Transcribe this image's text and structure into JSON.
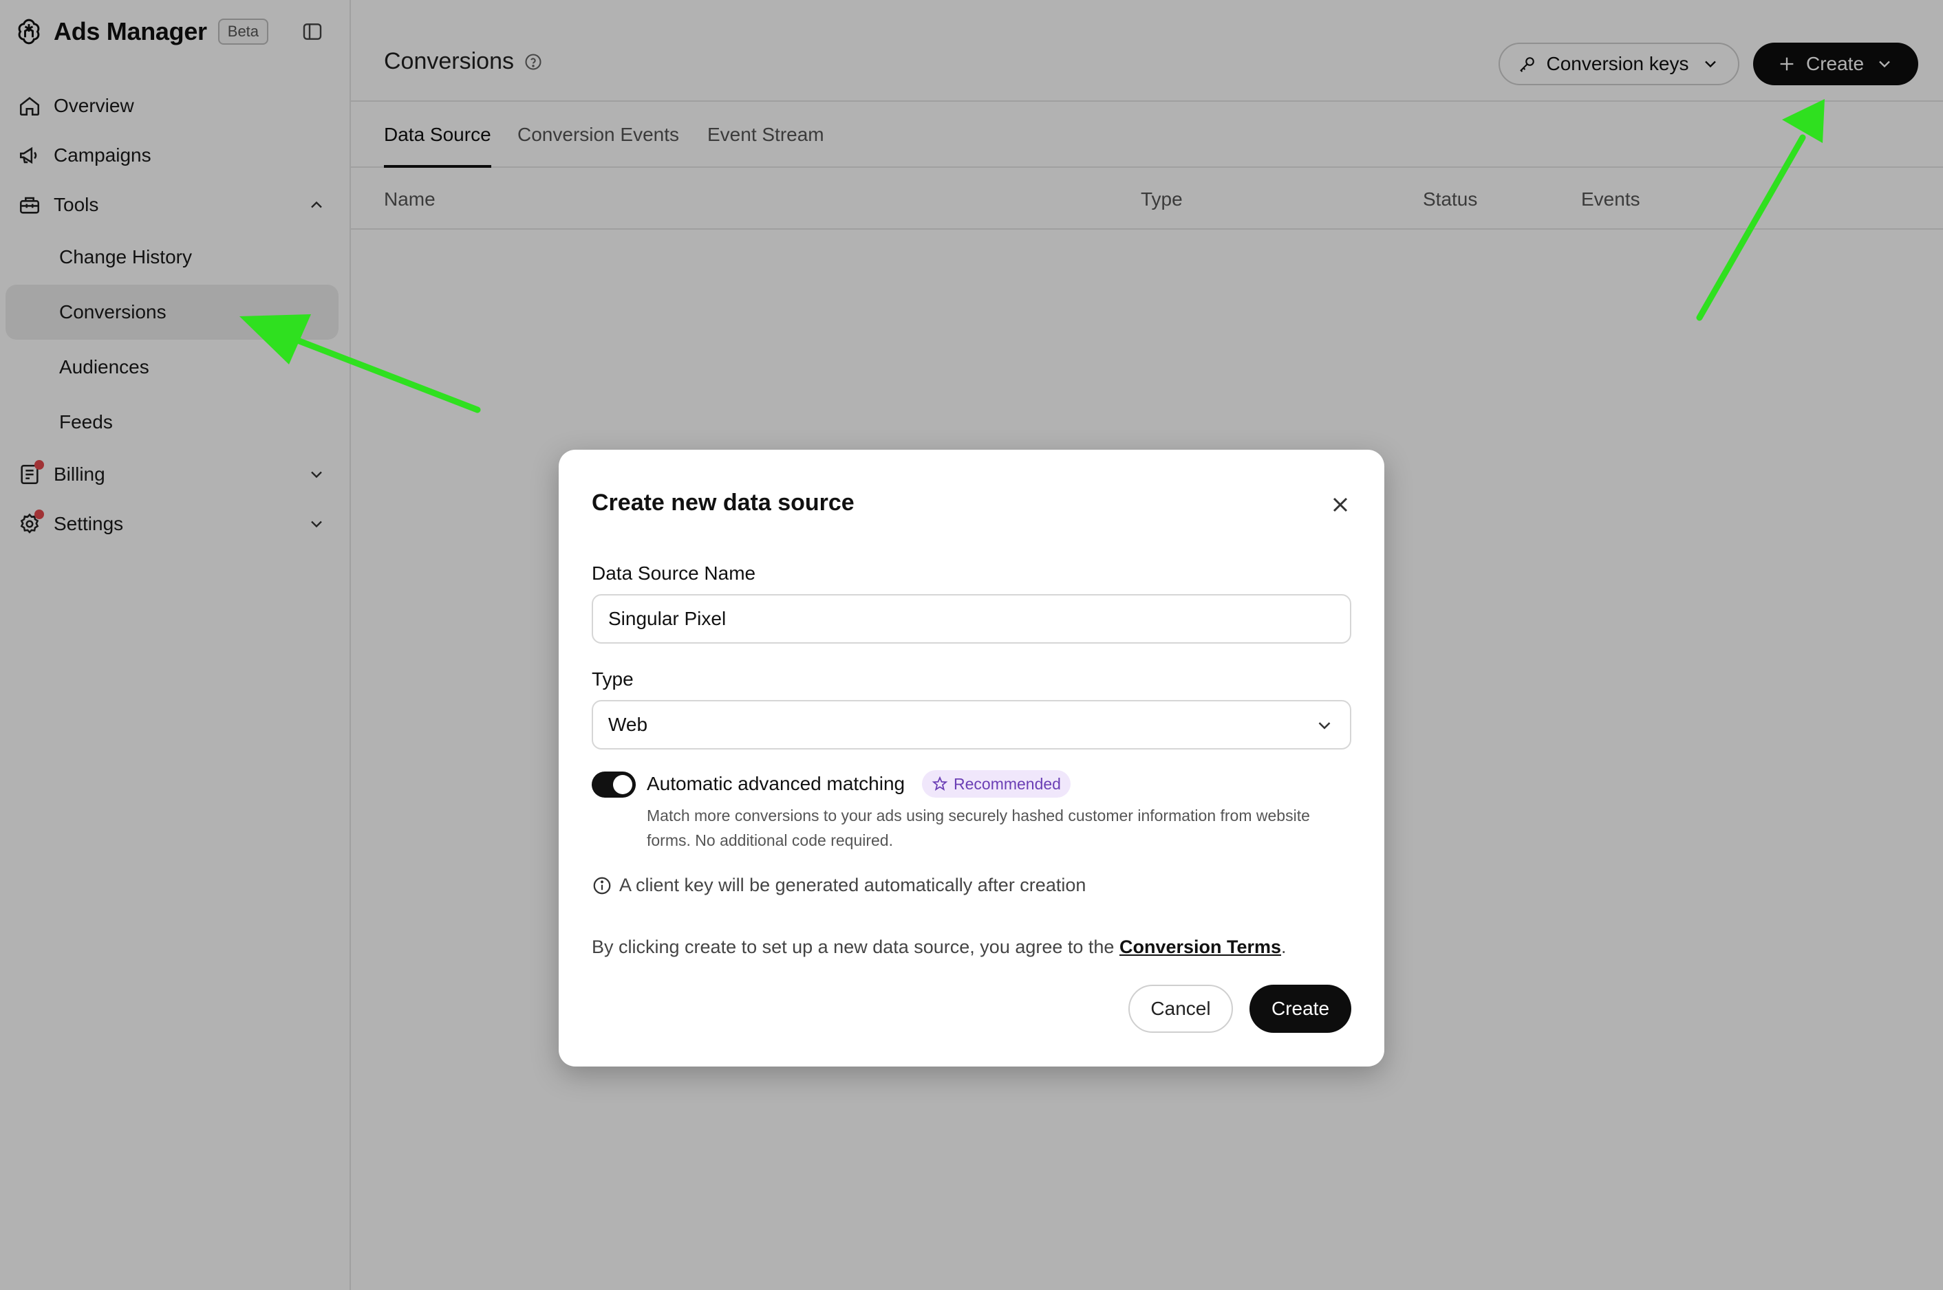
{
  "app": {
    "name": "Ads Manager",
    "badge": "Beta"
  },
  "sidebar": {
    "items": [
      {
        "label": "Overview"
      },
      {
        "label": "Campaigns"
      },
      {
        "label": "Tools"
      },
      {
        "label": "Change History"
      },
      {
        "label": "Conversions"
      },
      {
        "label": "Audiences"
      },
      {
        "label": "Feeds"
      },
      {
        "label": "Billing"
      },
      {
        "label": "Settings"
      }
    ]
  },
  "header": {
    "title": "Conversions",
    "conversion_keys_label": "Conversion keys",
    "create_label": "Create"
  },
  "tabs": [
    {
      "label": "Data Source"
    },
    {
      "label": "Conversion Events"
    },
    {
      "label": "Event Stream"
    }
  ],
  "table": {
    "columns": [
      "Name",
      "Type",
      "Status",
      "Events"
    ]
  },
  "modal": {
    "title": "Create new data source",
    "name_label": "Data Source Name",
    "name_value": "Singular Pixel",
    "type_label": "Type",
    "type_value": "Web",
    "matching_title": "Automatic advanced matching",
    "matching_badge": "Recommended",
    "matching_desc": "Match more conversions to your ads using securely hashed customer information from website forms. No additional code required.",
    "info_text": "A client key will be generated automatically after creation",
    "terms_prefix": "By clicking create to set up a new data source, you agree to the ",
    "terms_link": "Conversion Terms",
    "terms_suffix": ".",
    "cancel_label": "Cancel",
    "create_label": "Create"
  },
  "colors": {
    "arrow": "#2fe01f",
    "primary_button": "#0d0d0d",
    "badge_bg": "#f0e7fb",
    "badge_text": "#6b3fb5",
    "notification_dot": "#e5484d"
  }
}
